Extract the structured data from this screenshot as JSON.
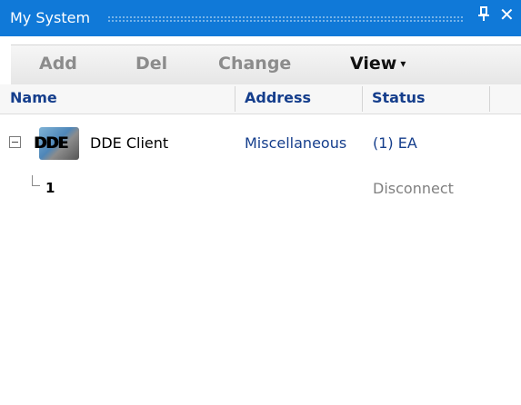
{
  "window": {
    "title": "My System",
    "pin_icon": "pin-icon",
    "close_icon": "close-icon",
    "pin_glyph": "ᵖ",
    "close_glyph": "✕"
  },
  "toolbar": {
    "add_label": "Add",
    "del_label": "Del",
    "change_label": "Change",
    "view_label": "View",
    "view_caret": "▾"
  },
  "columns": {
    "name": "Name",
    "address": "Address",
    "status": "Status"
  },
  "rows": [
    {
      "icon_label": "DDE",
      "name": "DDE Client",
      "address": "Miscellaneous",
      "status": "(1) EA",
      "expanded": true
    },
    {
      "name": "1",
      "status": "Disconnect"
    }
  ],
  "colors": {
    "titlebar": "#1079d8",
    "header_text": "#153e8c",
    "disabled_text": "#8c8c8c"
  }
}
